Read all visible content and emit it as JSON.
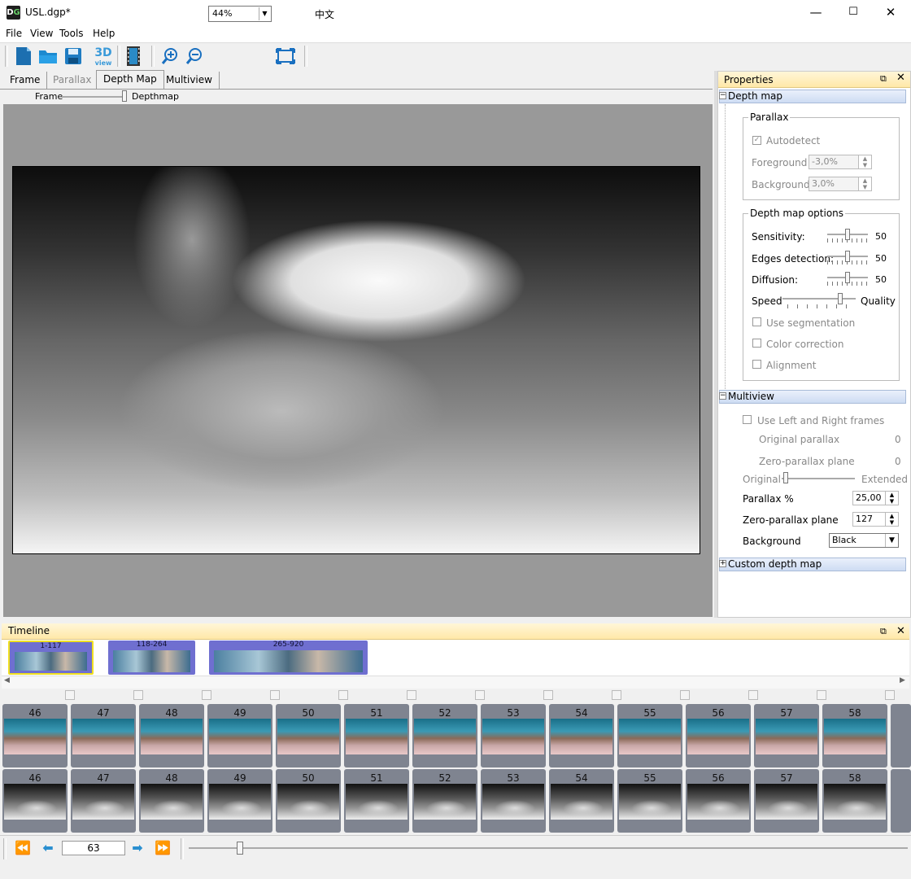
{
  "window": {
    "title": "USL.dgp*",
    "minimize": "—",
    "maximize": "☐",
    "close": "✕"
  },
  "menu": [
    "File",
    "View",
    "Tools",
    "Help"
  ],
  "toolbar": {
    "zoom": "44%",
    "lang": "中文",
    "view3d": "3D"
  },
  "tabs": [
    "Frame",
    "Parallax",
    "Depth Map",
    "Multiview"
  ],
  "view_slider": {
    "left": "Frame",
    "right": "Depthmap"
  },
  "properties": {
    "title": "Properties",
    "depth_map": {
      "header": "Depth map",
      "parallax": {
        "label": "Parallax",
        "autodetect": "Autodetect",
        "foreground_label": "Foreground",
        "foreground": "-3,0%",
        "background_label": "Background",
        "background": "3,0%"
      },
      "options": {
        "label": "Depth map options",
        "sensitivity_label": "Sensitivity:",
        "sensitivity": "50",
        "edges_label": "Edges detection:",
        "edges": "50",
        "diffusion_label": "Diffusion:",
        "diffusion": "50",
        "speed": "Speed",
        "quality": "Quality",
        "use_seg": "Use segmentation",
        "color_corr": "Color correction",
        "alignment": "Alignment"
      }
    },
    "multiview": {
      "header": "Multiview",
      "use_lr": "Use Left and Right frames",
      "orig_parallax_label": "Original parallax",
      "orig_parallax": "0",
      "zero_plane_label": "Zero-parallax plane",
      "zero_plane": "0",
      "original": "Original",
      "extended": "Extended",
      "parallax_pct_label": "Parallax %",
      "parallax_pct": "25,00",
      "zero_plane2_label": "Zero-parallax plane",
      "zero_plane2": "127",
      "background_label": "Background",
      "background": "Black"
    },
    "custom": {
      "header": "Custom depth map"
    }
  },
  "timeline": {
    "title": "Timeline",
    "clips": [
      "1-117",
      "118-264",
      "265-920"
    ],
    "frames": [
      "46",
      "47",
      "48",
      "49",
      "50",
      "51",
      "52",
      "53",
      "54",
      "55",
      "56",
      "57",
      "58"
    ],
    "current_frame": "63"
  }
}
